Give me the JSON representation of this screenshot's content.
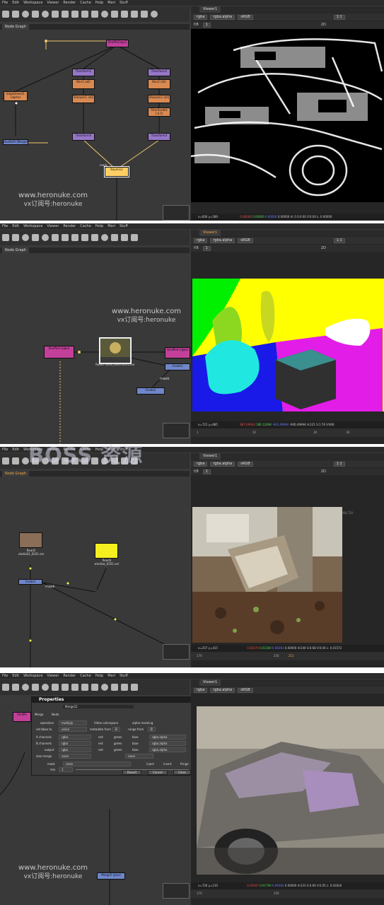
{
  "menu": [
    "File",
    "Edit",
    "Workspace",
    "Viewer",
    "Render",
    "Cache",
    "Help",
    "Mari",
    "Stuff"
  ],
  "node_graph_tab": "Node Graph",
  "viewer_tab": "Viewer1",
  "viewer_controls": {
    "channels": "rgba",
    "alpha": "rgba.alpha",
    "colorspace": "sRGB",
    "zoom": "1:1",
    "mode": "2D",
    "frame_f": "f/8",
    "frame_val": "1"
  },
  "watermark": {
    "url": "www.heronuke.com",
    "sub": "vx订阅号:heronuke"
  },
  "brand_watermark": "BOSS 资源",
  "panel1": {
    "nodes": [
      "ShuffleCopy1",
      "EdgeDetect1 (alpha)",
      "Transform1",
      "Blur1 (all)",
      "Sharpen1 (all)",
      "Transform4",
      "Transform2",
      "Blur2 (all)",
      "Sharpen2 (all)",
      "FilterErode1 (-0.5)",
      "Transform3",
      "Keymix3",
      "HueShift (Merge)",
      "mask"
    ],
    "info": {
      "coords": "x=606 y=289",
      "r": "0.00000",
      "g": "0.00000",
      "b": "0.00000",
      "a": "0.00000",
      "hsv": "H: 0 S:0.00 V:0.00",
      "l": "L: 0.00000"
    }
  },
  "panel2": {
    "nodes": [
      "Shuffle3 (rgba)",
      "Read7 birds_ADVs.0011.exr",
      "Shuffle4 (rgba)",
      "Grade1",
      "Grade2",
      "mask"
    ],
    "info": {
      "coords": "x=722 y=685",
      "r": "887.69934",
      "g": "186.12498",
      "b": "-903.49994",
      "a": "-900.49994",
      "hsv": "H:221 S:1.76 V:900"
    },
    "timeline": {
      "start": "1",
      "mid": "10",
      "end": "20",
      "last": "30"
    }
  },
  "panel3": {
    "nodes": [
      "Read1 vladia02_0201.exr",
      "Read3 window_0201.exr",
      "Grade1",
      "mask"
    ],
    "info": {
      "coords": "x=257 y=415",
      "r": "0.01470",
      "g": "0.01360",
      "b": "0.06263",
      "a": "0.00000",
      "hsv": "H:240 S:0.68 V:0.04",
      "l": "L: 0.01572"
    },
    "timeline": {
      "frame": "251",
      "start": "170",
      "mid": "250"
    },
    "format": "1280,720"
  },
  "panel4": {
    "props_title": "Properties",
    "node_name": "Merge22",
    "tabs": [
      "Merge",
      "Node"
    ],
    "rows": [
      {
        "label": "operation",
        "value": "multiply",
        "extra": "Video colorspace",
        "extra2": "alpha masking"
      },
      {
        "label": "set bbox to",
        "value": "union",
        "extra": "metadata from",
        "extra_val": "B",
        "extra2": "range from",
        "extra2_val": "B"
      },
      {
        "label": "A channels",
        "value": "rgba",
        "r": "red",
        "g": "green",
        "b": "blue",
        "a": "rgba.alpha"
      },
      {
        "label": "B channels",
        "value": "rgba",
        "r": "red",
        "g": "green",
        "b": "blue",
        "a": "rgba.alpha"
      },
      {
        "label": "output",
        "value": "rgba",
        "r": "red",
        "g": "green",
        "b": "blue",
        "a": "rgba.alpha"
      },
      {
        "label": "also merge",
        "value": "none",
        "extra": "none"
      },
      {
        "label": "mask",
        "value": "none",
        "extra": "inject",
        "extra2": "invert",
        "extra3": "fringe"
      },
      {
        "label": "mix",
        "value": "1"
      }
    ],
    "buttons": [
      "Revert",
      "Cancel",
      "Close"
    ],
    "nodes": [
      "Shuffle",
      "Merge5 (plus)"
    ],
    "info": {
      "coords": "x=726 y=210",
      "r": "0.05167",
      "g": "0.01790",
      "b": "0.09365",
      "a": "0.00000",
      "hsv": "H:333 S:0.66 V:0.05",
      "l": "L: 0.02626"
    },
    "timeline": {
      "start": "170",
      "mid": "250"
    }
  }
}
